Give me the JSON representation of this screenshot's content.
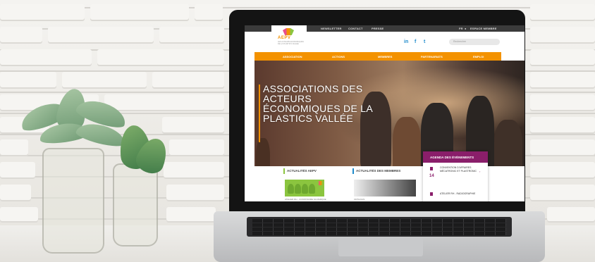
{
  "site": {
    "topbar_links": [
      "NEWSLETTER",
      "CONTACT",
      "PRESSE"
    ],
    "topbar_right": "FR",
    "topbar_member": "ESPACE MEMBRE",
    "logo_text": "AEPV",
    "logo_sub": "LES ACTEURS ECONOMIQUES DE LA PLASTICS VALLEE",
    "social": [
      "in",
      "f",
      "t"
    ],
    "search_placeholder": "Rechercher",
    "nav": [
      "ASSOCIATION",
      "ACTIONS",
      "MEMBRES",
      "PARTENARIATS",
      "EMPLOI"
    ],
    "hero_title": "ASSOCIATIONS DES ACTEURS ÉCONOMIQUES DE LA PLASTICS VALLÉE",
    "agenda": {
      "header": "AGENDA DES ÉVÈNEMENTS",
      "items": [
        {
          "day": "14",
          "text": "CONVENTION D'AFFAIRES MÉCATRONIC ET PLASTRONIC"
        },
        {
          "day": "",
          "text": "ATELIER RH - RADIOGRAPHIE"
        }
      ]
    },
    "news_aepv": "ACTUALITÉS AEPV",
    "news_members": "ACTUALITÉS DES MEMBRES",
    "caption_left": "ATELIER RH - CONSTRUIRE SA MARQUE",
    "caption_right": "ORTHOLIS"
  },
  "colors": {
    "accent_orange": "#f39200",
    "agenda_purple": "#8a1e6a",
    "green": "#8bc53f",
    "social_blue": "#1d8acb"
  }
}
